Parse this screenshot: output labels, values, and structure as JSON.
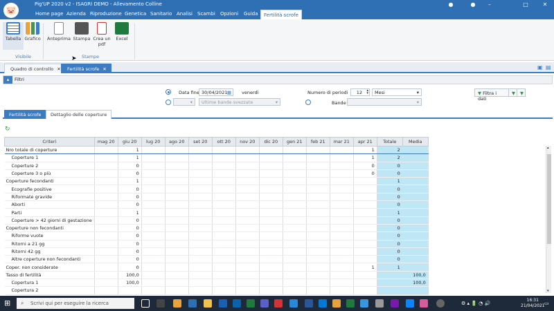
{
  "window": {
    "title": "Pig'UP 2020 v2 - ISAGRI DEMO - Allevamento Colline",
    "logo": "pig-logo-icon"
  },
  "menu": [
    "Home page",
    "Azienda",
    "Riproduzione",
    "Genetica",
    "Sanitario",
    "Analisi",
    "Scambi",
    "Opzioni",
    "Guida",
    "Fertilità scrofe"
  ],
  "ribbon": {
    "tabella": "Tabella",
    "grafico": "Grafico",
    "visibile": "Visibile",
    "anteprima": "Anteprima",
    "stampa": "Stampa",
    "crea_pdf_1": "Crea un",
    "crea_pdf_2": "pdf",
    "excel": "Excel",
    "stampe": "Stampe"
  },
  "doctabs": [
    "Quadro di controllo",
    "Fertilità scrofe"
  ],
  "filters": {
    "title": "Filtri",
    "data_fine_label": "Data fine",
    "data_fine_value": "30/04/2021",
    "day": "venerdì",
    "numero_periodi_label": "Numero di periodi",
    "numero_periodi_value": "12",
    "unit": "Mesi",
    "ultime_bande": "Ultime bande svezzate",
    "bande_label": "Bande",
    "filtra": "Filtra i dati"
  },
  "subtabs": [
    "Fertilità scrofe",
    "Dettaglio delle coperture"
  ],
  "grid": {
    "headers": [
      "Criteri",
      "mag 20",
      "giu 20",
      "lug 20",
      "ago 20",
      "set 20",
      "ott 20",
      "nov 20",
      "dic 20",
      "gen 21",
      "feb 21",
      "mar 21",
      "apr 21",
      "Totale",
      "Media"
    ],
    "rows": [
      {
        "label": "Nro totale di coperture",
        "ind": false,
        "giu": "1",
        "apr": "1",
        "tot": "2",
        "med": ""
      },
      {
        "label": "Coperture 1",
        "ind": true,
        "giu": "1",
        "apr": "1",
        "tot": "2",
        "med": ""
      },
      {
        "label": "Coperture 2",
        "ind": true,
        "giu": "0",
        "apr": "0",
        "tot": "0",
        "med": ""
      },
      {
        "label": "Coperture 3 o più",
        "ind": true,
        "giu": "0",
        "apr": "0",
        "tot": "0",
        "med": ""
      },
      {
        "label": "Coperture fecondanti",
        "ind": false,
        "giu": "1",
        "apr": "",
        "tot": "1",
        "med": ""
      },
      {
        "label": "Ecografie positive",
        "ind": true,
        "giu": "0",
        "apr": "",
        "tot": "0",
        "med": ""
      },
      {
        "label": "Riformate gravide",
        "ind": true,
        "giu": "0",
        "apr": "",
        "tot": "0",
        "med": ""
      },
      {
        "label": "Aborti",
        "ind": true,
        "giu": "0",
        "apr": "",
        "tot": "0",
        "med": ""
      },
      {
        "label": "Parti",
        "ind": true,
        "giu": "1",
        "apr": "",
        "tot": "1",
        "med": ""
      },
      {
        "label": "Coperture > 42 giorni di gestazione",
        "ind": true,
        "giu": "0",
        "apr": "",
        "tot": "0",
        "med": ""
      },
      {
        "label": "Coperture non fecondanti",
        "ind": false,
        "giu": "0",
        "apr": "",
        "tot": "0",
        "med": ""
      },
      {
        "label": "Riforme vuote",
        "ind": true,
        "giu": "0",
        "apr": "",
        "tot": "0",
        "med": ""
      },
      {
        "label": "Ritorni a 21 gg",
        "ind": true,
        "giu": "0",
        "apr": "",
        "tot": "0",
        "med": ""
      },
      {
        "label": "Ritorni 42 gg",
        "ind": true,
        "giu": "0",
        "apr": "",
        "tot": "0",
        "med": ""
      },
      {
        "label": "Altre coperture non fecondanti",
        "ind": true,
        "giu": "0",
        "apr": "",
        "tot": "0",
        "med": ""
      },
      {
        "label": "Coper. non considerate",
        "ind": false,
        "giu": "0",
        "apr": "1",
        "tot": "1",
        "med": ""
      },
      {
        "label": "Tasso di fertilità",
        "ind": false,
        "giu": "100,0",
        "apr": "",
        "tot": "",
        "med": "100,0"
      },
      {
        "label": "Copertura 1",
        "ind": true,
        "giu": "100,0",
        "apr": "",
        "tot": "",
        "med": "100,0"
      },
      {
        "label": "Copertura 2",
        "ind": true,
        "giu": "",
        "apr": "",
        "tot": "",
        "med": ""
      }
    ]
  },
  "taskbar": {
    "search": "Scrivi qui per eseguire la ricerca",
    "time": "16:31",
    "date": "21/04/2021"
  },
  "colors": {
    "accent": "#2f6fb3",
    "highlight_col": "#bfe6f5"
  }
}
